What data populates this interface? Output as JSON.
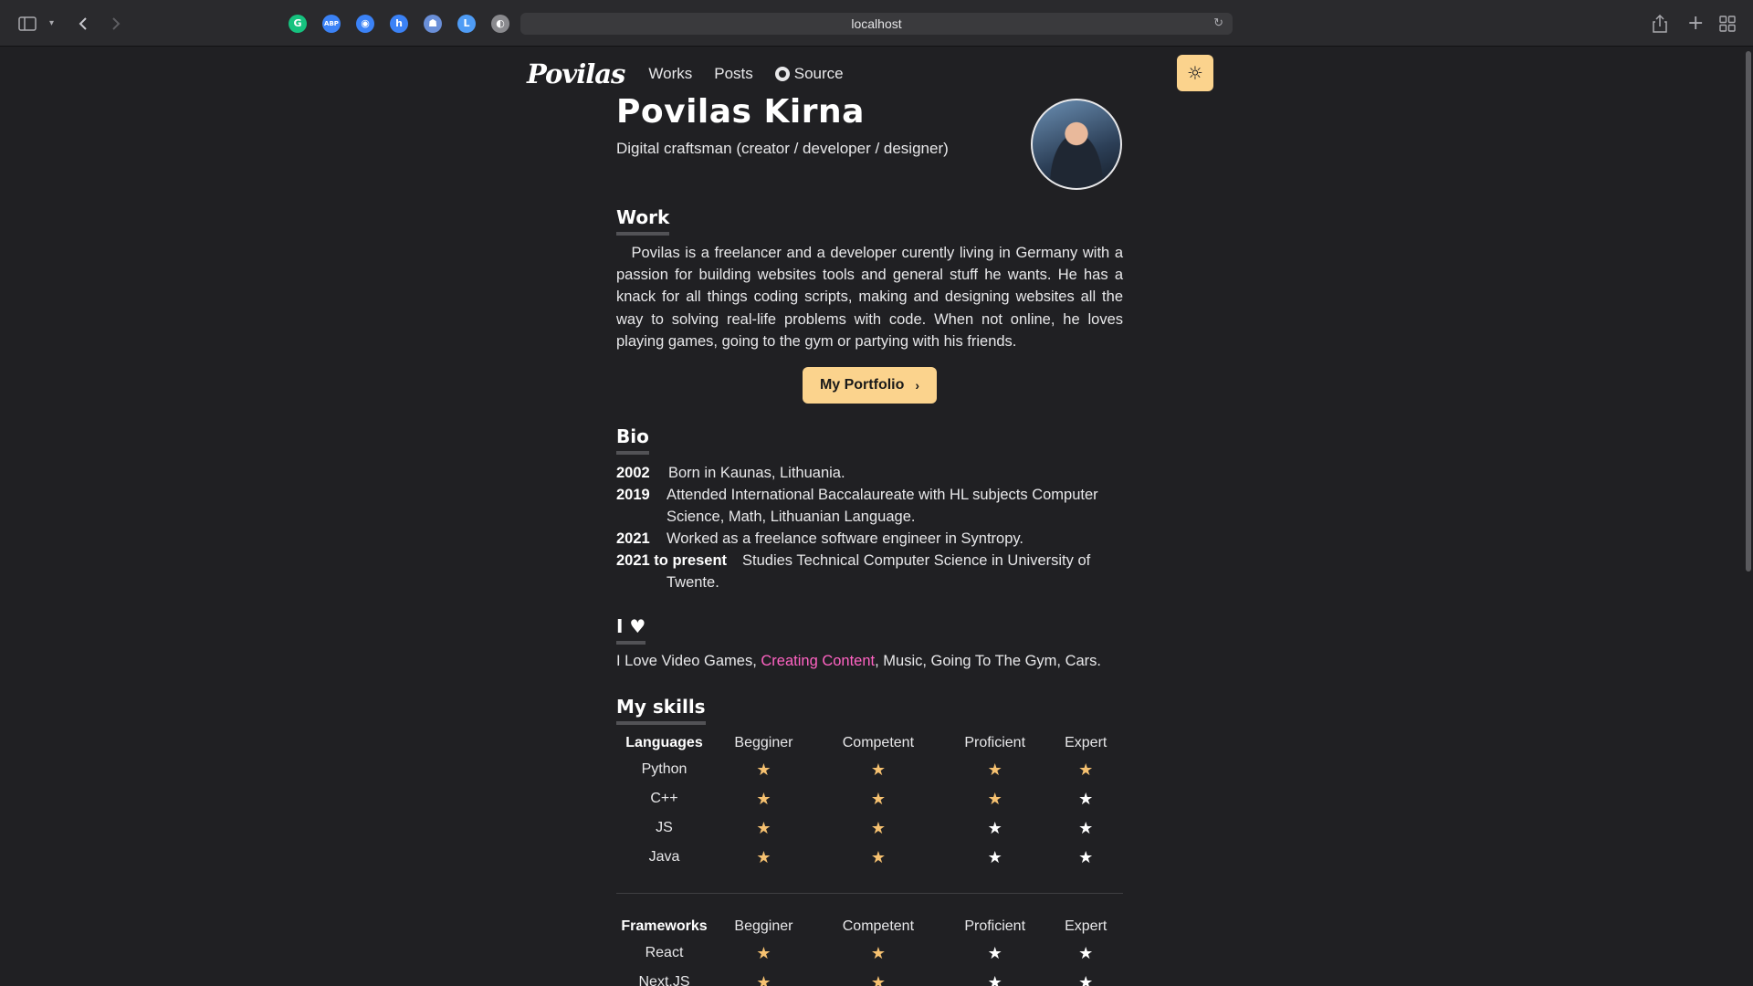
{
  "browser": {
    "url": "localhost",
    "extensions": [
      {
        "icon": "grammarly-icon",
        "glyph": "G",
        "color": "#16c27f"
      },
      {
        "icon": "adblock-icon",
        "glyph": "ABP",
        "color": "#3b82f6"
      },
      {
        "icon": "globe-extension-icon",
        "glyph": "◉",
        "color": "#3b82f6"
      },
      {
        "icon": "honey-icon",
        "glyph": "h",
        "color": "#3b82f6"
      },
      {
        "icon": "ghost-extension-icon",
        "glyph": "☗",
        "color": "#6a8fd8"
      },
      {
        "icon": "circle-extension-icon",
        "glyph": "L",
        "color": "#4f9cf5"
      },
      {
        "icon": "shield-extension-icon",
        "glyph": "◐",
        "color": "#8a8a8e"
      }
    ]
  },
  "nav": {
    "logo": "Povilas",
    "links": [
      "Works",
      "Posts",
      "Source"
    ]
  },
  "header": {
    "name": "Povilas Kirna",
    "subtitle": "Digital craftsman (creator / developer / designer)"
  },
  "work": {
    "heading": "Work",
    "paragraph": "Povilas is a freelancer and a developer curently living in Germany with a passion for building websites tools and general stuff he wants. He has a knack for all things coding scripts, making and designing websites all the way to solving real-life problems with code. When not online, he loves playing games, going to the gym or partying with his friends.",
    "button": "My Portfolio"
  },
  "bio": {
    "heading": "Bio",
    "entries": [
      {
        "year": "2002",
        "text": "Born in Kaunas, Lithuania."
      },
      {
        "year": "2019",
        "text": "Attended International Baccalaureate with HL subjects Computer",
        "text2": "Science, Math, Lithuanian Language."
      },
      {
        "year": "2021",
        "text": "Worked as a freelance software engineer in Syntropy."
      },
      {
        "year": "2021 to present",
        "text": "Studies Technical Computer Science in University of",
        "text2": "Twente."
      }
    ]
  },
  "loves": {
    "heading": "I ♥",
    "prefix": "I Love Video Games, ",
    "highlight": "Creating Content",
    "suffix": ", Music, Going To The Gym, Cars."
  },
  "skills": {
    "heading": "My skills",
    "levels": [
      "Begginer",
      "Competent",
      "Proficient",
      "Expert"
    ],
    "groups": [
      {
        "title": "Languages",
        "items": [
          {
            "name": "Python",
            "rating": 4
          },
          {
            "name": "C++",
            "rating": 3
          },
          {
            "name": "JS",
            "rating": 2
          },
          {
            "name": "Java",
            "rating": 2
          }
        ]
      },
      {
        "title": "Frameworks",
        "items": [
          {
            "name": "React",
            "rating": 2
          },
          {
            "name": "Next.JS",
            "rating": 2
          }
        ]
      }
    ]
  }
}
